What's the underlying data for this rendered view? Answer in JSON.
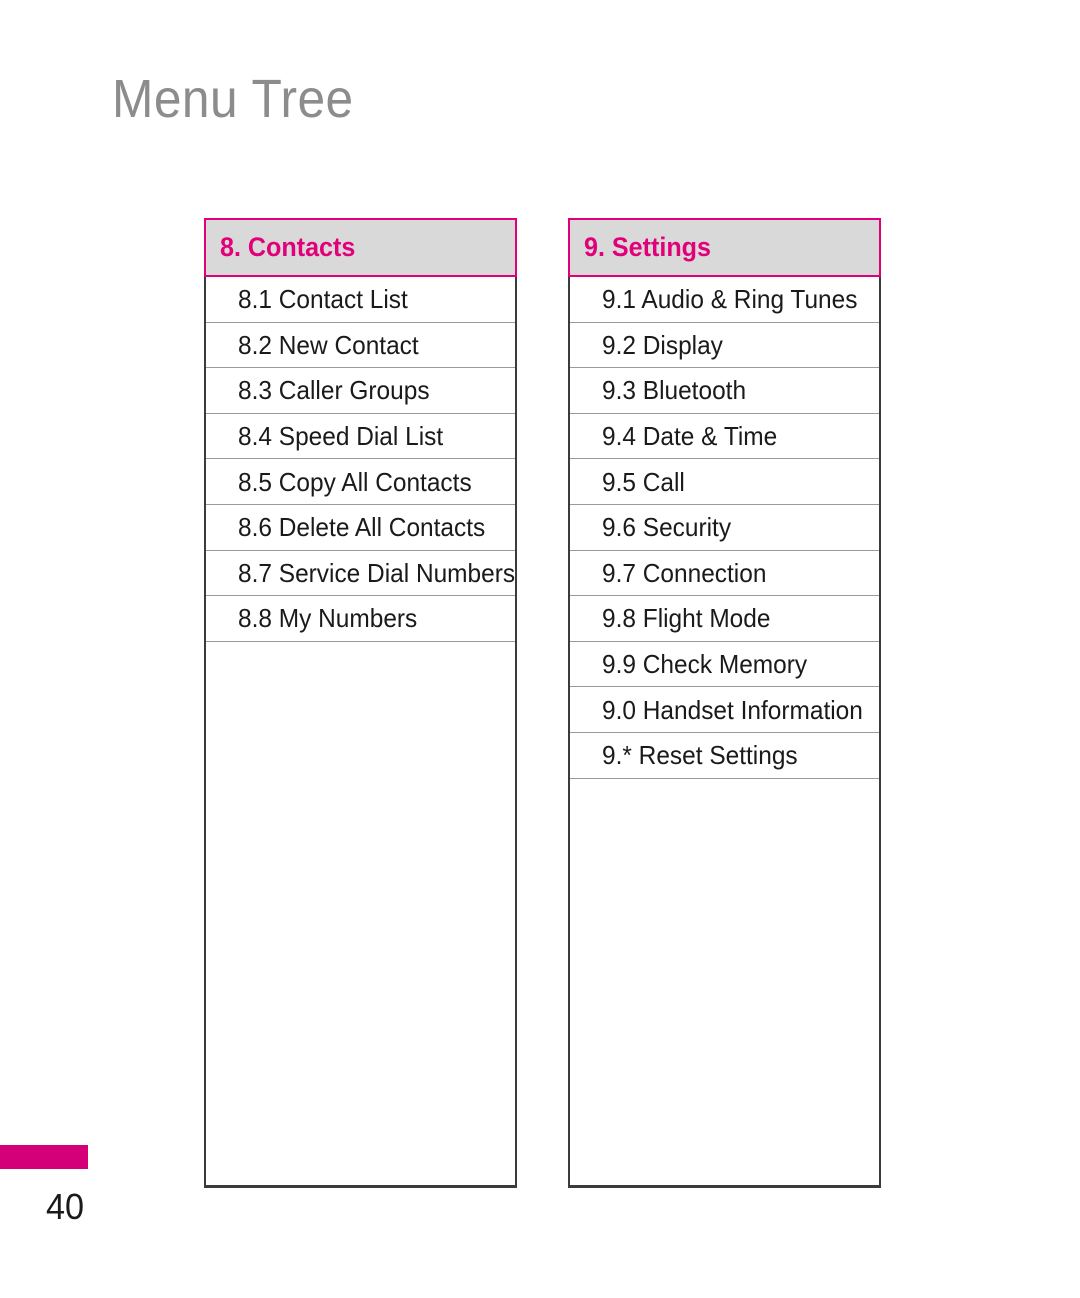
{
  "page": {
    "title": "Menu Tree",
    "number": "40",
    "accent_color": "#d4007a",
    "header_bg_color": "#d9d9d9",
    "title_color": "#8c8c8c"
  },
  "columns": [
    {
      "header": "8. Contacts",
      "items": [
        "8.1 Contact List",
        "8.2 New Contact",
        "8.3 Caller Groups",
        "8.4 Speed Dial List",
        "8.5 Copy All Contacts",
        "8.6 Delete All Contacts",
        "8.7 Service Dial Numbers",
        "8.8 My Numbers"
      ]
    },
    {
      "header": "9. Settings",
      "items": [
        "9.1 Audio & Ring Tunes",
        "9.2 Display",
        "9.3 Bluetooth",
        "9.4 Date & Time",
        "9.5 Call",
        "9.6 Security",
        "9.7 Connection",
        "9.8 Flight Mode",
        "9.9 Check Memory",
        "9.0 Handset Information",
        "9.* Reset Settings"
      ]
    }
  ]
}
